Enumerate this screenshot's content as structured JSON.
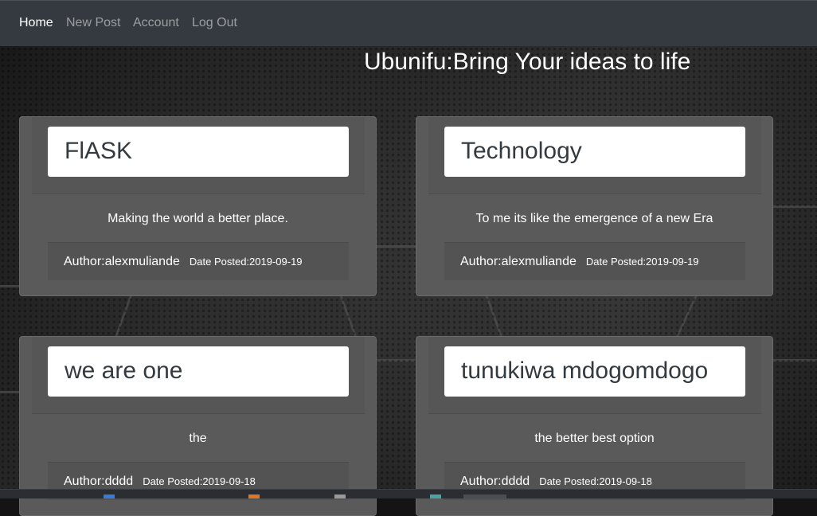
{
  "nav": {
    "items": [
      {
        "label": "Home",
        "active": true
      },
      {
        "label": "New Post",
        "active": false
      },
      {
        "label": "Account",
        "active": false
      },
      {
        "label": "Log Out",
        "active": false
      }
    ]
  },
  "page": {
    "title": "Ubunifu:Bring Your ideas to life"
  },
  "posts": [
    {
      "title": "FlASK",
      "description": "Making the world a better place.",
      "author": "Author:alexmuliande",
      "date": "Date Posted:2019-09-19"
    },
    {
      "title": "Technology",
      "description": "To me its like the emergence of a new Era",
      "author": "Author:alexmuliande",
      "date": "Date Posted:2019-09-19"
    },
    {
      "title": "we are one",
      "description": "the",
      "author": "Author:dddd",
      "date": "Date Posted:2019-09-18"
    },
    {
      "title": "tunukiwa mdogomdogo",
      "description": "the better best option",
      "author": "Author:dddd",
      "date": "Date Posted:2019-09-18"
    }
  ],
  "colors": {
    "navbar": "#343a40",
    "card": "#5a5a5a",
    "accent_white": "#ffffff"
  }
}
